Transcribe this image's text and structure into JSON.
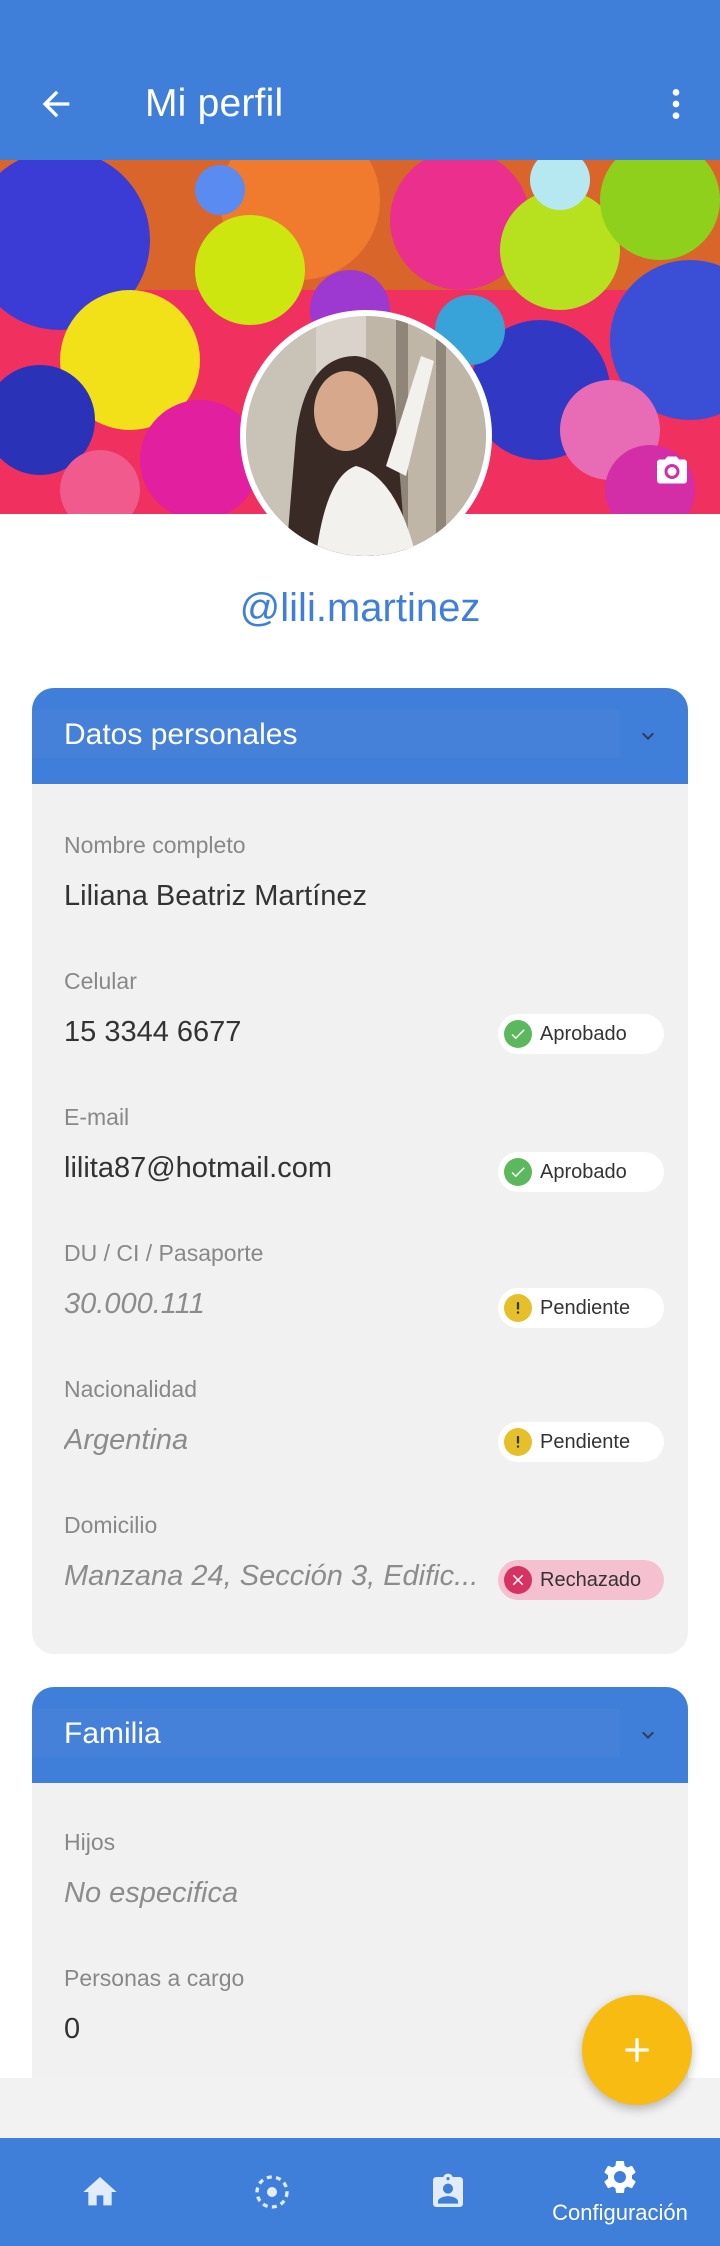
{
  "appbar": {
    "title": "Mi perfil"
  },
  "profile": {
    "username": "@lili.martinez"
  },
  "sections": {
    "personal": {
      "title": "Datos personales",
      "fields": [
        {
          "label": "Nombre completo",
          "value": "Liliana Beatriz Martínez"
        },
        {
          "label": "Celular",
          "value": "15 3344 6677",
          "status": "Aprobado"
        },
        {
          "label": "E-mail",
          "value": "lilita87@hotmail.com",
          "status": "Aprobado"
        },
        {
          "label": "DU / CI / Pasaporte",
          "value": "30.000.111",
          "status": "Pendiente"
        },
        {
          "label": "Nacionalidad",
          "value": "Argentina",
          "status": "Pendiente"
        },
        {
          "label": "Domicilio",
          "value": "Manzana 24, Sección 3, Edific...",
          "status": "Rechazado"
        }
      ]
    },
    "family": {
      "title": "Familia",
      "fields": [
        {
          "label": "Hijos",
          "value": "No especifica"
        },
        {
          "label": "Personas a cargo",
          "value": "0"
        }
      ]
    }
  },
  "bottom_nav": {
    "items": [
      {
        "icon": "home-icon"
      },
      {
        "icon": "dashed-circle-icon"
      },
      {
        "icon": "contact-card-icon"
      },
      {
        "icon": "gear-icon",
        "label": "Configuración",
        "active": true
      }
    ]
  },
  "colors": {
    "primary": "#3f7fd9",
    "accent_fab": "#f7bb12",
    "approved": "#5cb85c",
    "pending": "#e5c02a",
    "rejected": "#d63365"
  }
}
